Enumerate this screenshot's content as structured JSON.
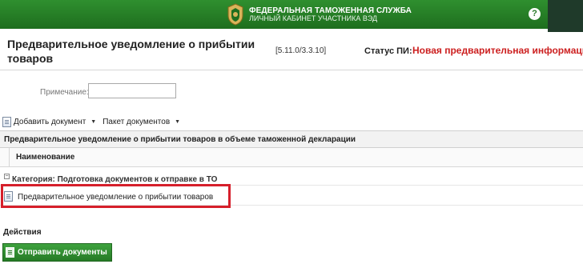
{
  "app": {
    "service_title": "ФЕДЕРАЛЬНАЯ ТАМОЖЕННАЯ СЛУЖБА",
    "service_subtitle": "ЛИЧНЫЙ КАБИНЕТ УЧАСТНИКА ВЭД",
    "help_label": "?",
    "brand_color": "#2a7a2a"
  },
  "header": {
    "title": "Предварительное уведомление о прибытии товаров",
    "version": "[5.11.0/3.3.10]",
    "status_label": "Статус ПИ:",
    "status_value": "Новая предварительная информация",
    "status_color": "#cc1f1f"
  },
  "form": {
    "note_label": "Примечание:",
    "note_value": ""
  },
  "toolbar": {
    "add_document_label": "Добавить документ",
    "add_document_icon": "document-icon",
    "package_label": "Пакет документов"
  },
  "grid": {
    "title": "Предварительное уведомление о прибытии товаров в объеме таможенной декларации",
    "column_name": "Наименование",
    "category_label": "Категория: Подготовка документов к отправке в ТО",
    "rows": [
      {
        "label": "Предварительное уведомление о прибытии товаров",
        "icon": "document-icon"
      }
    ]
  },
  "actions": {
    "label": "Действия",
    "send_button": "Отправить документы",
    "send_icon": "document-icon"
  }
}
